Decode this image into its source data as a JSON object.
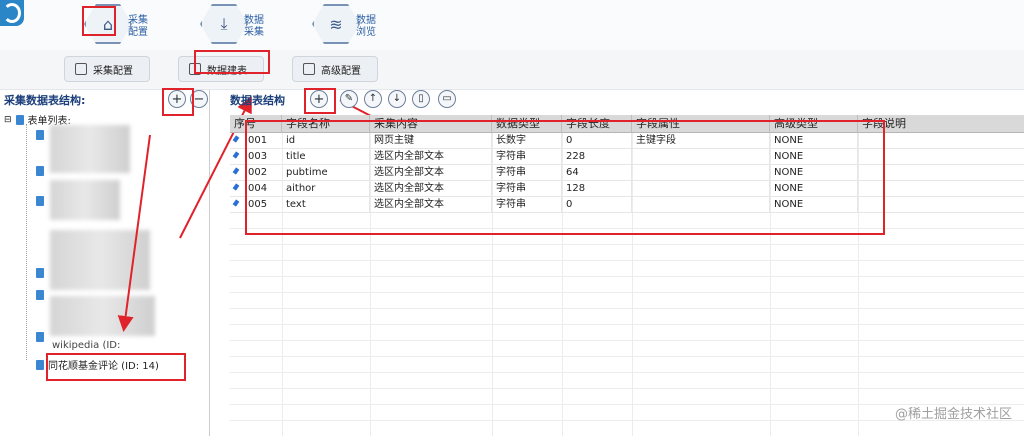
{
  "toolbar": {
    "tabs": [
      {
        "icon": "home-icon",
        "line1": "采集",
        "line2": "配置"
      },
      {
        "icon": "download-icon",
        "line1": "数据",
        "line2": "采集"
      },
      {
        "icon": "layers-icon",
        "line1": "数据",
        "line2": "浏览"
      }
    ]
  },
  "subtoolbar": {
    "buttons": [
      "采集配置",
      "数据建表",
      "高级配置"
    ]
  },
  "left_panel": {
    "title": "采集数据表结构:",
    "add_label": "+",
    "remove_label": "−",
    "tree_root": "表单列表:",
    "partial_item": "wikipedia (ID:",
    "highlight_item": "同花顺基金评论 (ID: 14)"
  },
  "right_panel": {
    "title": "数据表结构",
    "add_label": "+",
    "columns": [
      "序号",
      "字段名称",
      "采集内容",
      "数据类型",
      "字段长度",
      "字段属性",
      "高级类型",
      "字段说明"
    ],
    "rows": [
      {
        "no": "001",
        "name": "id",
        "content": "网页主键",
        "type": "长数字",
        "length": "0",
        "attr": "主键字段",
        "adv": "NONE",
        "desc": ""
      },
      {
        "no": "003",
        "name": "title",
        "content": "选区内全部文本",
        "type": "字符串",
        "length": "228",
        "attr": "",
        "adv": "NONE",
        "desc": ""
      },
      {
        "no": "002",
        "name": "pubtime",
        "content": "选区内全部文本",
        "type": "字符串",
        "length": "64",
        "attr": "",
        "adv": "NONE",
        "desc": ""
      },
      {
        "no": "004",
        "name": "aithor",
        "content": "选区内全部文本",
        "type": "字符串",
        "length": "128",
        "attr": "",
        "adv": "NONE",
        "desc": ""
      },
      {
        "no": "005",
        "name": "text",
        "content": "选区内全部文本",
        "type": "字符串",
        "length": "0",
        "attr": "",
        "adv": "NONE",
        "desc": ""
      }
    ]
  },
  "watermark": "@稀土掘金技术社区"
}
